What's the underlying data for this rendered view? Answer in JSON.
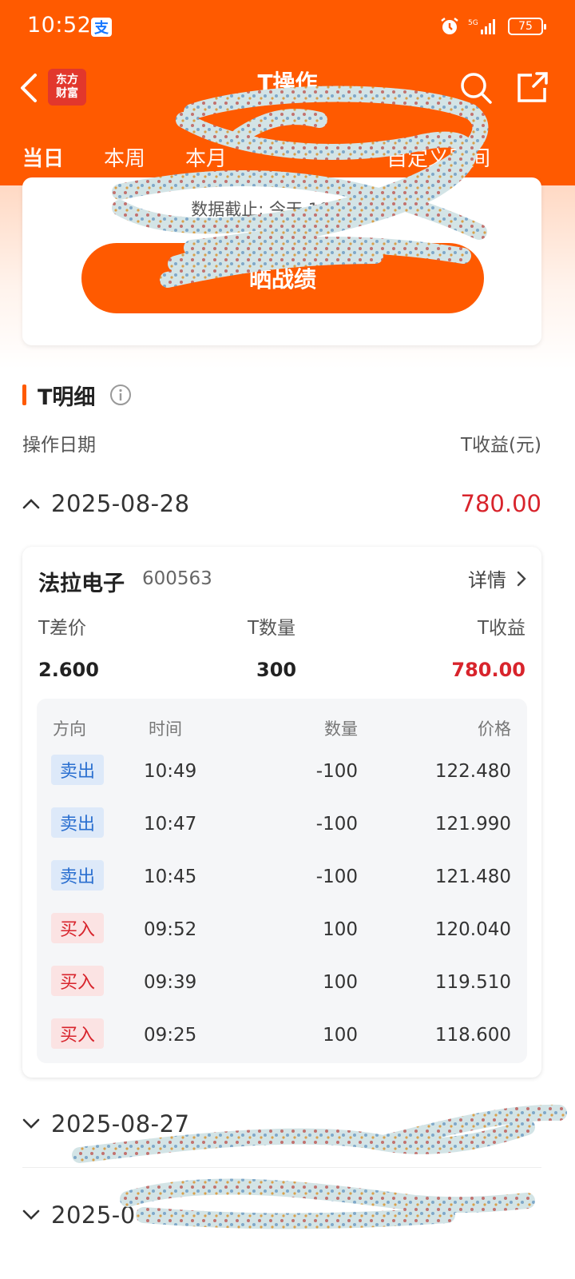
{
  "status_bar": {
    "time": "10:52",
    "battery": "75",
    "network": "5G"
  },
  "header": {
    "logo_line1": "东方",
    "logo_line2": "财富",
    "title": "T操作",
    "tabs": [
      "当日",
      "本周",
      "本月",
      "",
      "",
      "",
      "自定义区间"
    ]
  },
  "summary": {
    "data_cutoff": "数据截止: 今天 10:52:2",
    "share_button": "晒战绩"
  },
  "detail": {
    "section_title": "T明细",
    "col_date": "操作日期",
    "col_profit": "T收益(元)",
    "groups": [
      {
        "date": "2025-08-28",
        "profit": "780.00",
        "expanded": true
      },
      {
        "date": "2025-08-27",
        "profit": "",
        "expanded": false
      },
      {
        "date": "2025-0",
        "profit": "",
        "expanded": false
      }
    ],
    "stock": {
      "name": "法拉电子",
      "code": "600563",
      "detail_link": "详情",
      "labels": {
        "spread": "T差价",
        "quantity": "T数量",
        "profit": "T收益"
      },
      "values": {
        "spread": "2.600",
        "quantity": "300",
        "profit": "780.00"
      },
      "trade_headers": {
        "direction": "方向",
        "time": "时间",
        "quantity": "数量",
        "price": "价格"
      },
      "trades": [
        {
          "direction": "卖出",
          "type": "sell",
          "time": "10:49",
          "quantity": "-100",
          "price": "122.480"
        },
        {
          "direction": "卖出",
          "type": "sell",
          "time": "10:47",
          "quantity": "-100",
          "price": "121.990"
        },
        {
          "direction": "卖出",
          "type": "sell",
          "time": "10:45",
          "quantity": "-100",
          "price": "121.480"
        },
        {
          "direction": "买入",
          "type": "buy",
          "time": "09:52",
          "quantity": "100",
          "price": "120.040"
        },
        {
          "direction": "买入",
          "type": "buy",
          "time": "09:39",
          "quantity": "100",
          "price": "119.510"
        },
        {
          "direction": "买入",
          "type": "buy",
          "time": "09:25",
          "quantity": "100",
          "price": "118.600"
        }
      ]
    }
  },
  "colors": {
    "brand_orange": "#ff5a00",
    "profit_red": "#d8242c",
    "sell_blue": "#2a6fd0"
  }
}
